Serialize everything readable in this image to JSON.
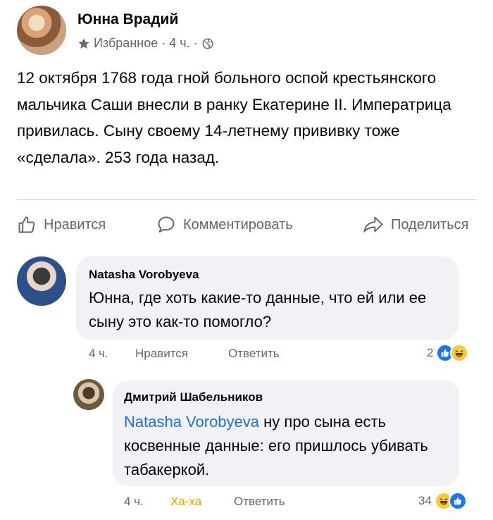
{
  "post": {
    "author": "Юнна Врадий",
    "meta_favorites": "Избранное",
    "meta_time": "4 ч.",
    "meta_sep1": "·",
    "meta_sep2": "·",
    "text": "12 октября 1768 года гной больного оспой крестьянского мальчика Саши внесли в ранку Екатерине II. Императрица привилась. Сыну своему 14-летнему прививку тоже «сделала». 253 года назад."
  },
  "actions": {
    "like": "Нравится",
    "comment": "Комментировать",
    "share": "Поделиться"
  },
  "comments": [
    {
      "author": "Natasha Vorobyeva",
      "text": "Юнна, где хоть какие-то данные, что ей или ее сыну это как-то помогло?",
      "time": "4 ч.",
      "like": "Нравится",
      "reply": "Ответить",
      "reactions_count": "2"
    },
    {
      "author": "Дмитрий Шабельников",
      "mention": "Natasha Vorobyeva",
      "text": "ну про сына есть косвенные данные: его пришлось убивать табакеркой.",
      "time": "4 ч.",
      "reaction_label": "Ха-ха",
      "reply": "Ответить",
      "reactions_count": "34"
    }
  ],
  "icons": {
    "favorites": "star-icon",
    "privacy": "globe-icon",
    "like": "thumbs-up-icon",
    "comment": "speech-bubble-icon",
    "share": "share-arrow-icon"
  },
  "colors": {
    "mention": "#216fdb",
    "haha_reaction_text": "#d9a800",
    "like_reaction": "#1877f2",
    "haha_reaction": "#f7c93d"
  }
}
